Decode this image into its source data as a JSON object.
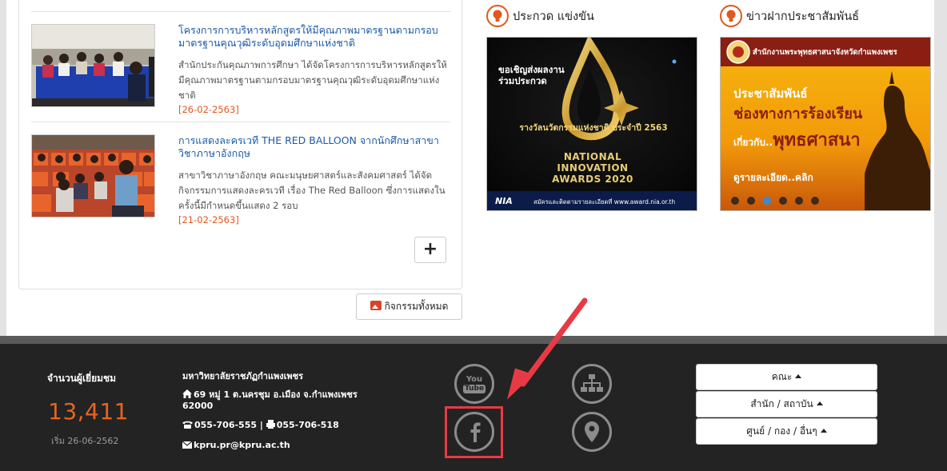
{
  "news": [
    {
      "title": "โครงการการบริหารหลักสูตรให้มีคุณภาพมาตรฐานตามกรอบมาตรฐานคุณวุฒิระดับอุดมศึกษาแห่งชาติ",
      "description": "สำนักประกันคุณภาพการศึกษา ได้จัดโครงการการบริหารหลักสูตรให้มีคุณภาพมาตรฐานตามกรอบมาตรฐานคุณวุฒิระดับอุดมศึกษาแห่งชาติ",
      "date": "[26-02-2563]"
    },
    {
      "title": "การแสดงละครเวที THE RED BALLOON จากนักศึกษาสาขาวิชาภาษาอังกฤษ",
      "description": "สาขาวิชาภาษาอังกฤษ คณะมนุษยศาสตร์และสังคมศาสตร์ ได้จัดกิจกรรมการแสดงละครเวที เรื่อง The Red Balloon ซึ่งการแสดงในครั้งนี้มีกำหนดขึ้นแสดง 2 รอบ",
      "date": "[21-02-2563]"
    }
  ],
  "more_button": "+",
  "all_activities_button": "กิจกรรมทั้งหมด",
  "sections": {
    "contest": {
      "title": "ประกวด แข่งขัน",
      "banner": {
        "invite_line1": "ขอเชิญส่งผลงาน",
        "invite_line2": "ร่วมประกวด",
        "award_thai": "รางวัลนวัตกรรมแห่งชาติ ประจำปี 2563",
        "award_en1": "NATIONAL",
        "award_en2": "INNOVATION",
        "award_en3": "AWARDS 2020",
        "logo": "NIA",
        "footer_text": "สมัครและติดตามรายละเอียดที่ www.award.nia.or.th"
      }
    },
    "pr": {
      "title": "ข่าวฝากประชาสัมพันธ์",
      "banner": {
        "org": "สำนักงานพระพุทธศาสนาจังหวัดกำแพงเพชร",
        "line1": "ประชาสัมพันธ์",
        "line2": "ช่องทางการร้องเรียน",
        "line3_prefix": "เกี่ยวกับ..",
        "line3_main": "พุทธศาสนา",
        "details": "ดูรายละเอียด..คลิก",
        "slides": 6,
        "active_slide": 3
      }
    }
  },
  "footer": {
    "visitors_label": "จำนวนผู้เยี่ยมชม",
    "visitors_count": "13,411",
    "visitors_since": "เริ่ม 26-06-2562",
    "university": "มหาวิทยาลัยราชภัฏกำแพงเพชร",
    "address": "69 หมู่ 1 ต.นครชุม อ.เมือง จ.กำแพงเพชร 62000",
    "phone": "055-706-555 | ",
    "fax": "055-706-518",
    "email": "kpru.pr@kpru.ac.th",
    "social": {
      "youtube_top": "You",
      "youtube_bottom": "Tube"
    },
    "menus": [
      "คณะ",
      "สำนัก / สถาบัน",
      "ศูนย์ / กอง / อื่นๆ"
    ]
  },
  "colors": {
    "accent_orange": "#e2571e",
    "link_blue": "#1a5aa9",
    "footer_bg": "#232323",
    "highlight_red": "#e83a45"
  }
}
